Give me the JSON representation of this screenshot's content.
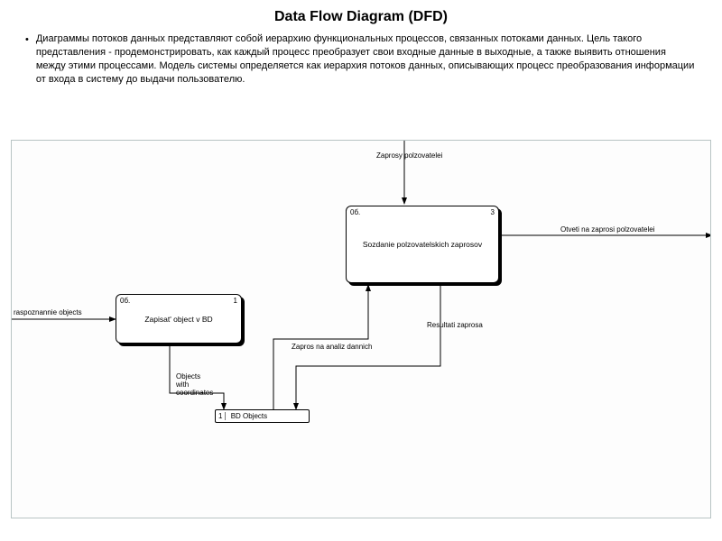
{
  "title": "Data Flow Diagram (DFD)",
  "paragraph": "Диаграммы потоков данных представляют собой иерархию функциональных процессов, связанных потоками данных. Цель такого представления - продемонстрировать, как каждый процесс преобразует свои входные данные в выходные, а также выявить отношения между этими процессами. Модель системы определяется как иерархия потоков данных, описывающих процесс преобразования информации от входа в систему до выдачи пользователю.",
  "diagram": {
    "nodes": {
      "process1": {
        "prefix": "0б.",
        "num": "1",
        "label": "Zapisat' object v BD"
      },
      "process3": {
        "prefix": "0б.",
        "num": "3",
        "label": "Sozdanie polzovatelskich zaprosov"
      },
      "datastore": {
        "num": "1",
        "label": "BD Objects"
      }
    },
    "flows": {
      "f_raspoznannie": "raspoznannie objects",
      "f_zaprosy": "Zaprosy polzovatelei",
      "f_otveti": "Otveti na zaprosi polzovatelei",
      "f_zapros_analiz": "Zapros na analiz dannich",
      "f_resultati": "Resultati zaprosa",
      "f_objects_coords": "Objects\nwith\ncoordinates"
    }
  }
}
